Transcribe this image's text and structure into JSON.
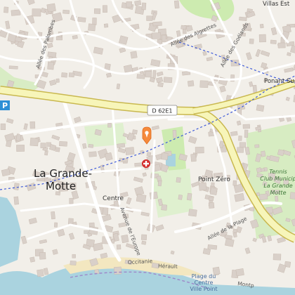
{
  "places": {
    "town": [
      "La Grande-",
      "Motte"
    ],
    "centre": "Centre",
    "point_zero": "Point Zéro",
    "ponant": "Ponant Sud",
    "villas": "Villas Est"
  },
  "roads": {
    "route_ref": "D 62E1",
    "allee_palombes": "Allée des Palombes",
    "allee_aigrettes": "Allée des Aigrettes",
    "allee_goelands": "Allée des Goélands",
    "avenue_europe": "Avenue de l'Europe",
    "allee_plage": "Allée de la Plage",
    "herault": "Hérault",
    "occitanie": "Occitanie",
    "montpellier": "Montp"
  },
  "pois": {
    "tennis": [
      "Tennis",
      "Club Municip",
      "La Grande",
      "Motte"
    ],
    "beach": [
      "Plage du",
      "Centre",
      "Ville Point"
    ],
    "parking": "P"
  },
  "markers": {
    "pin": "location-pin",
    "hospital": "hospital-cross"
  },
  "colors": {
    "land": "#f2efe9",
    "sea": "#aad3df",
    "sand": "#f3e7c0",
    "park": "#cdebb0",
    "motorway": "#f7f5b9",
    "motorway_edge": "#c9b84f",
    "building": "#d9d0c9",
    "pin": "#f58a3c",
    "hospital": "#d22b2b",
    "boundary": "#3f5bd9"
  }
}
